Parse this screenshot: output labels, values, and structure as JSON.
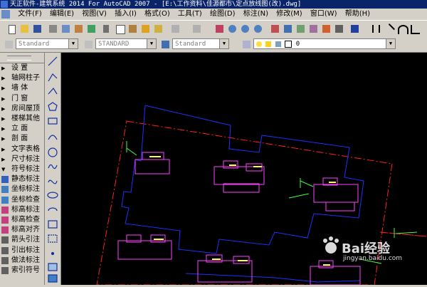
{
  "window": {
    "title": "天正软件-建筑系统 2014  For AutoCAD 2007 - [E:\\工作资料\\佳源都市\\定点放线图(改).dwg]"
  },
  "menubar": {
    "items": [
      "文件(F)",
      "编辑(E)",
      "视图(V)",
      "插入(I)",
      "格式(O)",
      "工具(T)",
      "绘图(D)",
      "标注(N)",
      "修改(M)",
      "窗口(W)",
      "帮助(H)"
    ]
  },
  "toolbar2": {
    "text_style": "Standard",
    "dim_style": "STANDARD",
    "table_style": "Standard",
    "layer_value": "0"
  },
  "left_panel": {
    "items": [
      {
        "label": "设  置",
        "icon": "arrow-right-icon"
      },
      {
        "label": "轴网柱子",
        "icon": "arrow-right-icon"
      },
      {
        "label": "墙    体",
        "icon": "arrow-right-icon"
      },
      {
        "label": "门    窗",
        "icon": "arrow-right-icon"
      },
      {
        "label": "房间屋顶",
        "icon": "arrow-right-icon"
      },
      {
        "label": "楼梯其他",
        "icon": "arrow-right-icon"
      },
      {
        "label": "立    面",
        "icon": "arrow-right-icon"
      },
      {
        "label": "剖    面",
        "icon": "arrow-right-icon"
      },
      {
        "label": "文字表格",
        "icon": "arrow-right-icon"
      },
      {
        "label": "尺寸标注",
        "icon": "arrow-right-icon"
      },
      {
        "label": "符号标注",
        "icon": "arrow-down-icon"
      },
      {
        "label": "静态标注",
        "icon": "static-label-icon"
      },
      {
        "label": "坐标标注",
        "icon": "coordinate-label-icon"
      },
      {
        "label": "坐标检查",
        "icon": "coordinate-check-icon"
      },
      {
        "label": "标高标注",
        "icon": "elevation-label-icon"
      },
      {
        "label": "标高检查",
        "icon": "elevation-check-icon"
      },
      {
        "label": "标高对齐",
        "icon": "elevation-align-icon"
      },
      {
        "label": "箭头引注",
        "icon": "arrow-note-icon"
      },
      {
        "label": "引出标注",
        "icon": "leader-label-icon"
      },
      {
        "label": "做法标注",
        "icon": "method-label-icon"
      },
      {
        "label": "索引符号",
        "icon": "index-symbol-icon"
      }
    ]
  },
  "watermark": {
    "brand": "Bai经验",
    "url": "jingyan.baidu.com"
  },
  "colors": {
    "outline_blue": "#2030ff",
    "outline_red": "#ff2020",
    "building_magenta": "#ff40ff",
    "highlight_yellow": "#ffff40",
    "label_green": "#40ff40"
  }
}
